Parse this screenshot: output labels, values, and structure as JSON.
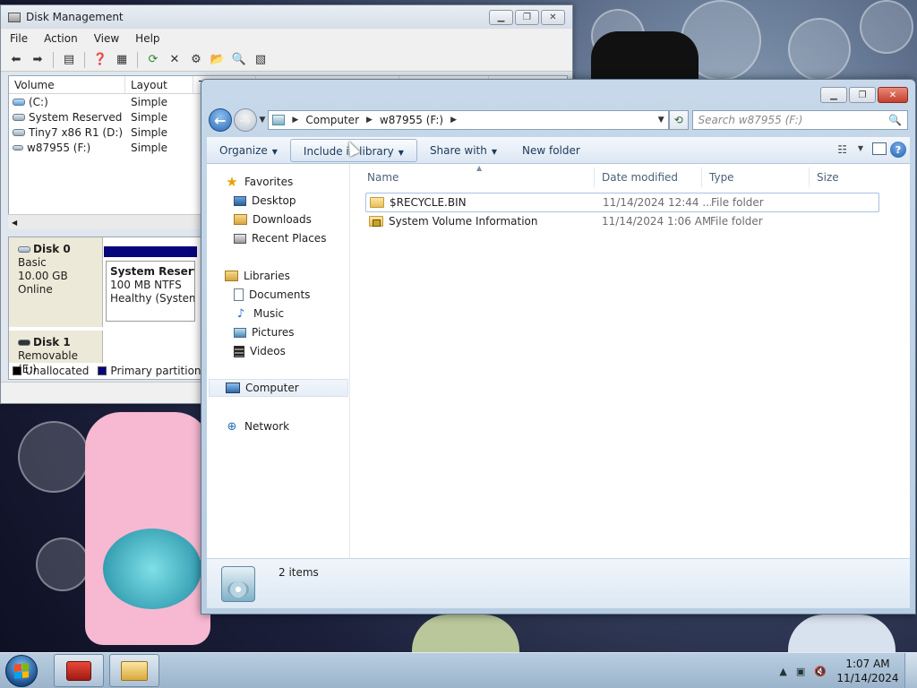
{
  "disk_mgmt": {
    "title": "Disk Management",
    "menu": [
      "File",
      "Action",
      "View",
      "Help"
    ],
    "columns": [
      "Volume",
      "Layout",
      "T"
    ],
    "volumes": [
      {
        "name": "(C:)",
        "layout": "Simple",
        "icon": "blue-drive-icon"
      },
      {
        "name": "System Reserved",
        "layout": "Simple",
        "icon": "drive-icon"
      },
      {
        "name": "Tiny7 x86 R1 (D:)",
        "layout": "Simple",
        "icon": "drive-icon"
      },
      {
        "name": "w87955 (F:)",
        "layout": "Simple",
        "icon": "removable-drive-icon"
      }
    ],
    "disk0": {
      "name": "Disk 0",
      "type": "Basic",
      "size": "10.00 GB",
      "status": "Online"
    },
    "disk0_partition": {
      "name": "System Reserve",
      "size": "100 MB NTFS",
      "status": "Healthy (System,"
    },
    "disk1": {
      "name": "Disk 1",
      "type": "Removable (E:)"
    },
    "legend": {
      "unallocated": "Unallocated",
      "primary": "Primary partition"
    },
    "colors": {
      "primary": "#06067a",
      "unallocated": "#000000"
    }
  },
  "explorer": {
    "breadcrumb": [
      "Computer",
      "w87955 (F:)"
    ],
    "search_placeholder": "Search w87955 (F:)",
    "commands": {
      "organize": "Organize",
      "include": "Include in library",
      "share": "Share with",
      "new_folder": "New folder"
    },
    "nav": {
      "favorites": "Favorites",
      "desktop": "Desktop",
      "downloads": "Downloads",
      "recent": "Recent Places",
      "libraries": "Libraries",
      "documents": "Documents",
      "music": "Music",
      "pictures": "Pictures",
      "videos": "Videos",
      "computer": "Computer",
      "network": "Network"
    },
    "columns": {
      "name": "Name",
      "date": "Date modified",
      "type": "Type",
      "size": "Size"
    },
    "files": [
      {
        "name": "$RECYCLE.BIN",
        "date": "11/14/2024 12:44 ...",
        "type": "File folder"
      },
      {
        "name": "System Volume Information",
        "date": "11/14/2024 1:06 AM",
        "type": "File folder"
      }
    ],
    "item_count": "2 items"
  },
  "taskbar": {
    "time": "1:07 AM",
    "date": "11/14/2024"
  }
}
